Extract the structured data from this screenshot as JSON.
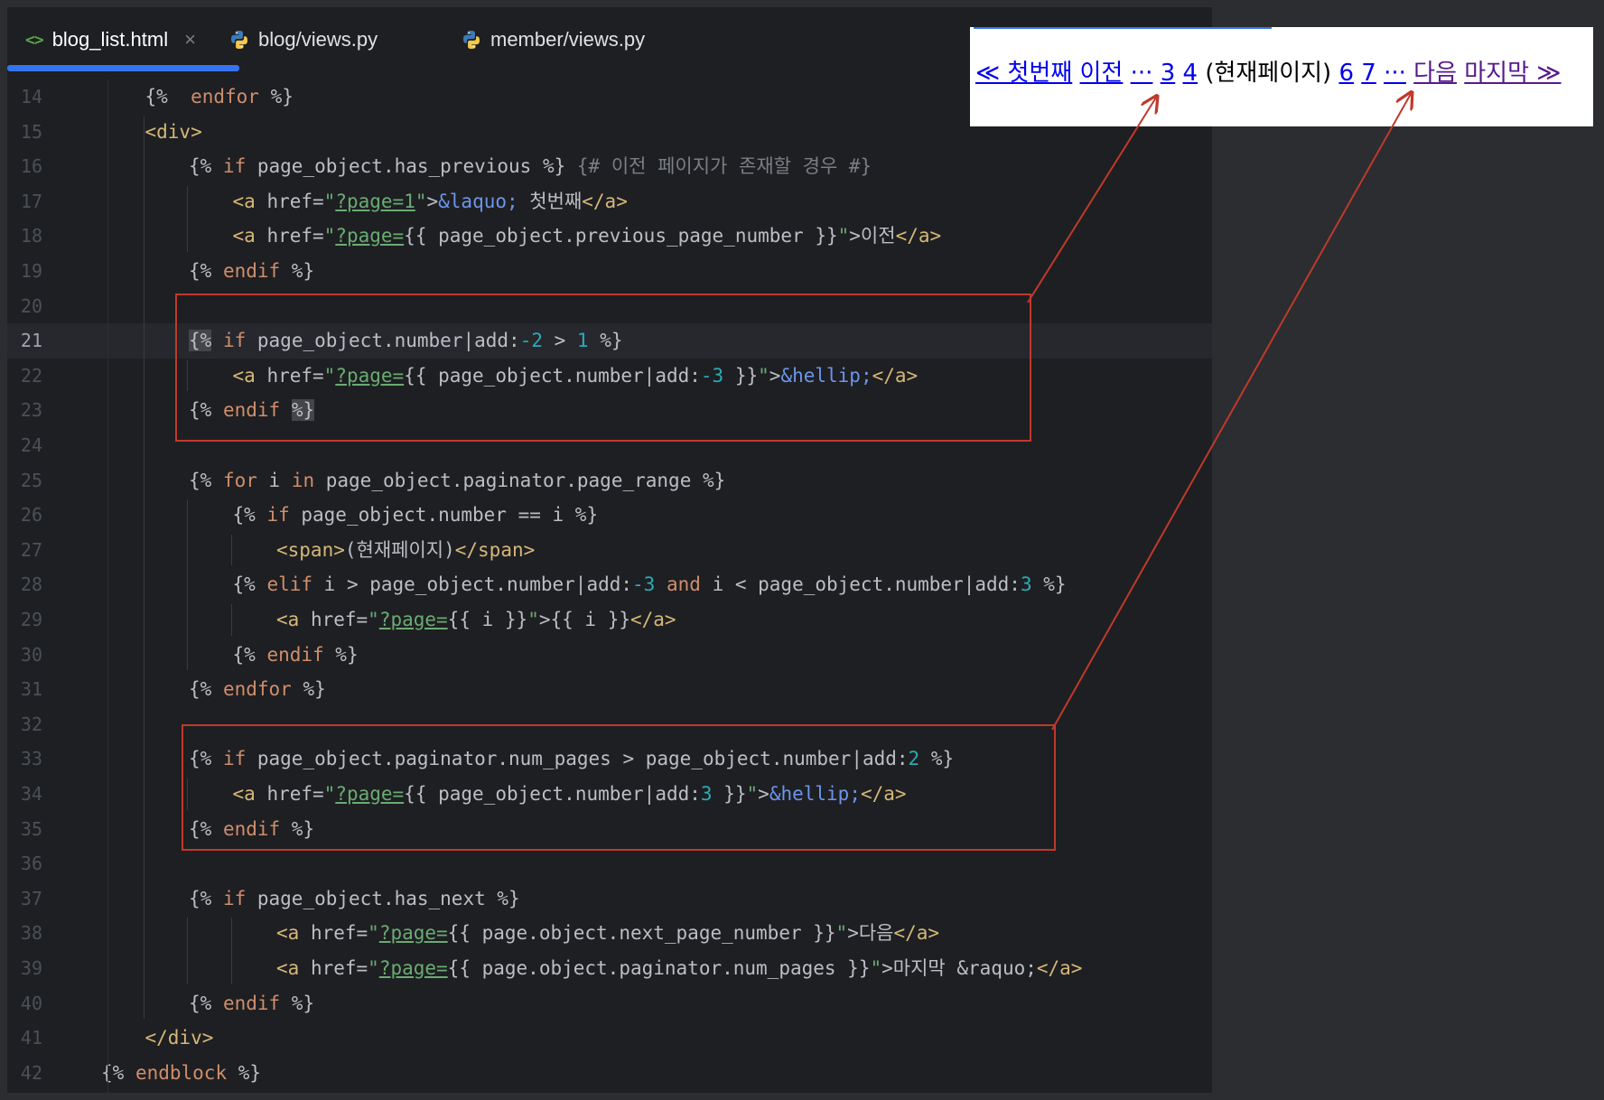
{
  "tabs": [
    {
      "label": "blog_list.html",
      "icon": "html-icon",
      "active": true
    },
    {
      "label": "blog/views.py",
      "icon": "python-icon",
      "active": false
    },
    {
      "label": "member/views.py",
      "icon": "python-icon",
      "active": false
    }
  ],
  "tab_close": "×",
  "html_icon_glyph": "<>",
  "current_line": 21,
  "lines": [
    {
      "n": "14",
      "indent": 1,
      "tokens": [
        [
          "delim",
          "{% "
        ],
        [
          "kw",
          " endfor"
        ],
        [
          "delim",
          " %}"
        ]
      ]
    },
    {
      "n": "15",
      "indent": 1,
      "tokens": [
        [
          "tag",
          "<div>"
        ]
      ]
    },
    {
      "n": "16",
      "indent": 2,
      "tokens": [
        [
          "delim",
          "{% "
        ],
        [
          "kw",
          "if"
        ],
        [
          "delim",
          " page_object.has_previous %} "
        ],
        [
          "cm",
          "{# 이전 페이지가 존재할 경우 #}"
        ]
      ]
    },
    {
      "n": "17",
      "indent": 3,
      "tokens": [
        [
          "tag",
          "<a "
        ],
        [
          "delim",
          "href="
        ],
        [
          "str",
          "\""
        ],
        [
          "link",
          "?page=1"
        ],
        [
          "str",
          "\""
        ],
        [
          "delim",
          ">"
        ],
        [
          "ent",
          "&laquo;"
        ],
        [
          "delim",
          " 첫번째"
        ],
        [
          "tag",
          "</a>"
        ]
      ]
    },
    {
      "n": "18",
      "indent": 3,
      "tokens": [
        [
          "tag",
          "<a "
        ],
        [
          "delim",
          "href="
        ],
        [
          "str",
          "\""
        ],
        [
          "link",
          "?page="
        ],
        [
          "delim",
          "{{ page_object.previous_page_number }}"
        ],
        [
          "str",
          "\""
        ],
        [
          "delim",
          ">이전"
        ],
        [
          "tag",
          "</a>"
        ]
      ]
    },
    {
      "n": "19",
      "indent": 2,
      "tokens": [
        [
          "delim",
          "{% "
        ],
        [
          "kw",
          "endif"
        ],
        [
          "delim",
          " %}"
        ]
      ]
    },
    {
      "n": "20",
      "indent": 0,
      "tokens": []
    },
    {
      "n": "21",
      "indent": 2,
      "tokens": [
        [
          "match",
          "{%"
        ],
        [
          "delim",
          " "
        ],
        [
          "kw",
          "if"
        ],
        [
          "delim",
          " page_object.number|add:"
        ],
        [
          "num",
          "-2"
        ],
        [
          "delim",
          " > "
        ],
        [
          "num",
          "1"
        ],
        [
          "delim",
          " %}"
        ]
      ]
    },
    {
      "n": "22",
      "indent": 3,
      "tokens": [
        [
          "tag",
          "<a "
        ],
        [
          "delim",
          "href="
        ],
        [
          "str",
          "\""
        ],
        [
          "link",
          "?page="
        ],
        [
          "delim",
          "{{ page_object.number|add:"
        ],
        [
          "num",
          "-3"
        ],
        [
          "delim",
          " }}"
        ],
        [
          "str",
          "\""
        ],
        [
          "delim",
          ">"
        ],
        [
          "ent",
          "&hellip;"
        ],
        [
          "tag",
          "</a>"
        ]
      ]
    },
    {
      "n": "23",
      "indent": 2,
      "tokens": [
        [
          "delim",
          "{% "
        ],
        [
          "kw",
          "endif"
        ],
        [
          "delim",
          " "
        ],
        [
          "match",
          "%}"
        ]
      ]
    },
    {
      "n": "24",
      "indent": 0,
      "tokens": []
    },
    {
      "n": "25",
      "indent": 2,
      "tokens": [
        [
          "delim",
          "{% "
        ],
        [
          "kw",
          "for"
        ],
        [
          "delim",
          " i "
        ],
        [
          "kw",
          "in"
        ],
        [
          "delim",
          " page_object.paginator.page_range %}"
        ]
      ]
    },
    {
      "n": "26",
      "indent": 3,
      "tokens": [
        [
          "delim",
          "{% "
        ],
        [
          "kw",
          "if"
        ],
        [
          "delim",
          " page_object.number == i %}"
        ]
      ]
    },
    {
      "n": "27",
      "indent": 4,
      "tokens": [
        [
          "tag",
          "<span>"
        ],
        [
          "delim",
          "(현재페이지)"
        ],
        [
          "tag",
          "</span>"
        ]
      ]
    },
    {
      "n": "28",
      "indent": 3,
      "tokens": [
        [
          "delim",
          "{% "
        ],
        [
          "kw",
          "elif"
        ],
        [
          "delim",
          " i > page_object.number|add:"
        ],
        [
          "num",
          "-3"
        ],
        [
          "delim",
          " "
        ],
        [
          "kw",
          "and"
        ],
        [
          "delim",
          " i < page_object.number|add:"
        ],
        [
          "num",
          "3"
        ],
        [
          "delim",
          " %}"
        ]
      ]
    },
    {
      "n": "29",
      "indent": 4,
      "tokens": [
        [
          "tag",
          "<a "
        ],
        [
          "delim",
          "href="
        ],
        [
          "str",
          "\""
        ],
        [
          "link",
          "?page="
        ],
        [
          "delim",
          "{{ i }}"
        ],
        [
          "str",
          "\""
        ],
        [
          "delim",
          ">{{ i }}"
        ],
        [
          "tag",
          "</a>"
        ]
      ]
    },
    {
      "n": "30",
      "indent": 3,
      "tokens": [
        [
          "delim",
          "{% "
        ],
        [
          "kw",
          "endif"
        ],
        [
          "delim",
          " %}"
        ]
      ]
    },
    {
      "n": "31",
      "indent": 2,
      "tokens": [
        [
          "delim",
          "{% "
        ],
        [
          "kw",
          "endfor"
        ],
        [
          "delim",
          " %}"
        ]
      ]
    },
    {
      "n": "32",
      "indent": 0,
      "tokens": []
    },
    {
      "n": "33",
      "indent": 2,
      "tokens": [
        [
          "delim",
          "{% "
        ],
        [
          "kw",
          "if"
        ],
        [
          "delim",
          " page_object.paginator.num_pages > page_object.number|add:"
        ],
        [
          "num",
          "2"
        ],
        [
          "delim",
          " %}"
        ]
      ]
    },
    {
      "n": "34",
      "indent": 3,
      "tokens": [
        [
          "tag",
          "<a "
        ],
        [
          "delim",
          "href="
        ],
        [
          "str",
          "\""
        ],
        [
          "link",
          "?page="
        ],
        [
          "delim",
          "{{ page_object.number|add:"
        ],
        [
          "num",
          "3"
        ],
        [
          "delim",
          " }}"
        ],
        [
          "str",
          "\""
        ],
        [
          "delim",
          ">"
        ],
        [
          "ent",
          "&hellip;"
        ],
        [
          "tag",
          "</a>"
        ]
      ]
    },
    {
      "n": "35",
      "indent": 2,
      "tokens": [
        [
          "delim",
          "{% "
        ],
        [
          "kw",
          "endif"
        ],
        [
          "delim",
          " %}"
        ]
      ]
    },
    {
      "n": "36",
      "indent": 0,
      "tokens": []
    },
    {
      "n": "37",
      "indent": 2,
      "tokens": [
        [
          "delim",
          "{% "
        ],
        [
          "kw",
          "if"
        ],
        [
          "delim",
          " page_object.has_next %}"
        ]
      ]
    },
    {
      "n": "38",
      "indent": 4,
      "tokens": [
        [
          "tag",
          "<a "
        ],
        [
          "delim",
          "href="
        ],
        [
          "str",
          "\""
        ],
        [
          "link",
          "?page="
        ],
        [
          "delim",
          "{{ page.object.next_page_number }}"
        ],
        [
          "str",
          "\""
        ],
        [
          "delim",
          ">다음"
        ],
        [
          "tag",
          "</a>"
        ]
      ]
    },
    {
      "n": "39",
      "indent": 4,
      "tokens": [
        [
          "tag",
          "<a "
        ],
        [
          "delim",
          "href="
        ],
        [
          "str",
          "\""
        ],
        [
          "link",
          "?page="
        ],
        [
          "delim",
          "{{ page.object.paginator.num_pages }}"
        ],
        [
          "str",
          "\""
        ],
        [
          "delim",
          ">마지막 &raquo;"
        ],
        [
          "tag",
          "</a>"
        ]
      ]
    },
    {
      "n": "40",
      "indent": 2,
      "tokens": [
        [
          "delim",
          "{% "
        ],
        [
          "kw",
          "endif"
        ],
        [
          "delim",
          " %}"
        ]
      ]
    },
    {
      "n": "41",
      "indent": 1,
      "tokens": [
        [
          "tag",
          "</div>"
        ]
      ]
    },
    {
      "n": "42",
      "indent": 0,
      "tokens": [
        [
          "delim",
          "{% "
        ],
        [
          "kw",
          "endblock"
        ],
        [
          "delim",
          " %}"
        ]
      ]
    }
  ],
  "preview": {
    "first": "≪ 첫번째",
    "prev": "이전",
    "ellipsis_left": "···",
    "page_3": "3",
    "page_4": "4",
    "current": "(현재페이지)",
    "page_6": "6",
    "page_7": "7",
    "ellipsis_right": "···",
    "next": "다음",
    "last": "마지막 ≫"
  },
  "colors": {
    "editor_bg": "#1e1f22",
    "tab_accent": "#3574f0",
    "annotation_red": "#c0392b",
    "link_blue": "#0000ee",
    "link_visited": "#551a8b"
  }
}
